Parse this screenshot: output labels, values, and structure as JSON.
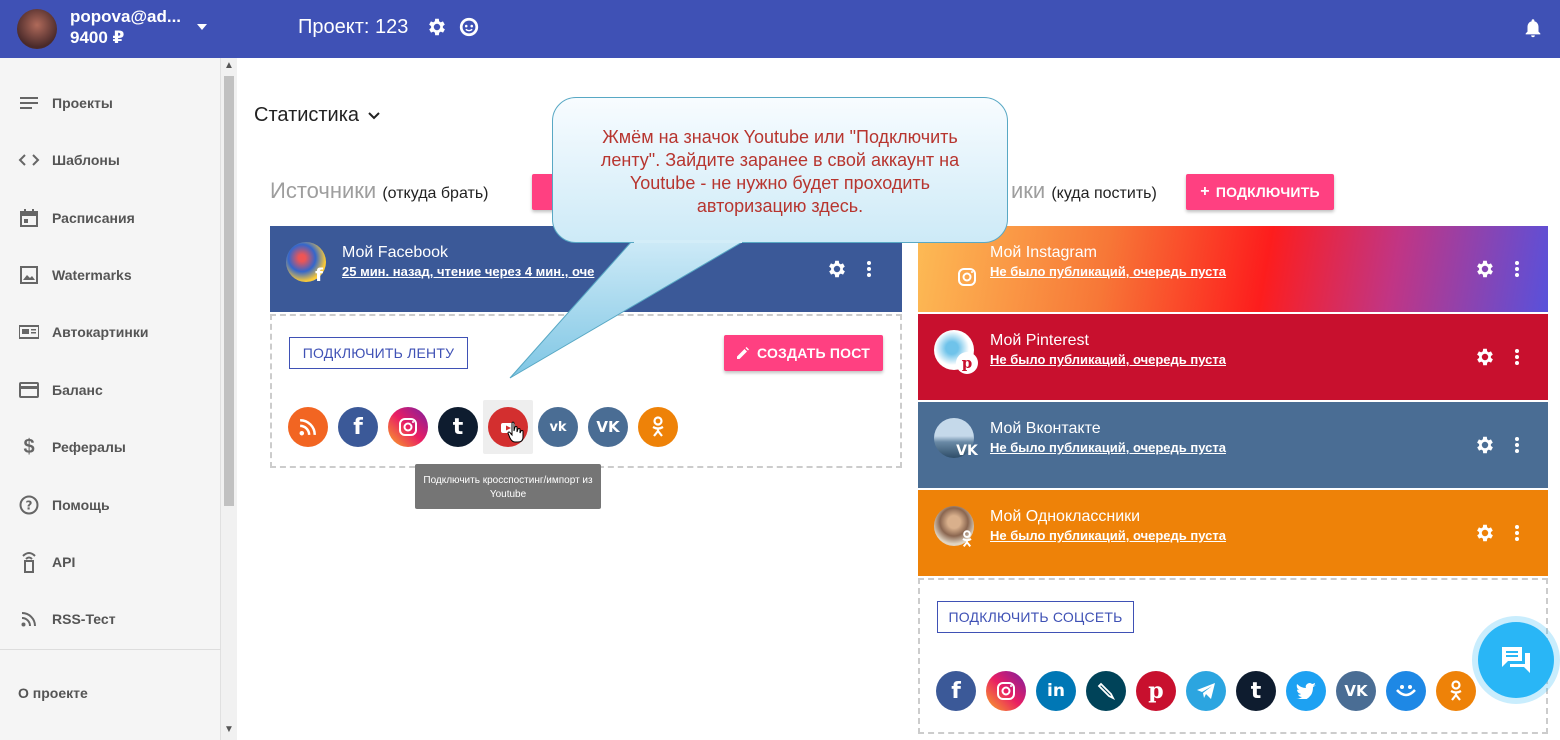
{
  "header": {
    "user_name": "popova@ad...",
    "balance": "9400 ₽",
    "project_title": "Проект: 123"
  },
  "sidebar": {
    "items": [
      {
        "label": "Проекты",
        "icon": "list-icon"
      },
      {
        "label": "Шаблоны",
        "icon": "code-icon"
      },
      {
        "label": "Расписания",
        "icon": "calendar-icon"
      },
      {
        "label": "Watermarks",
        "icon": "image-icon"
      },
      {
        "label": "Автокартинки",
        "icon": "featured-video-icon"
      },
      {
        "label": "Баланс",
        "icon": "credit-card-icon"
      },
      {
        "label": "Рефералы",
        "icon": "dollar-icon"
      },
      {
        "label": "Помощь",
        "icon": "help-icon"
      },
      {
        "label": "API",
        "icon": "api-icon"
      },
      {
        "label": "RSS-Тест",
        "icon": "rss-icon"
      }
    ],
    "about": "О проекте"
  },
  "stats": {
    "title": "Статистика"
  },
  "sources": {
    "title": "Источники",
    "subtitle": "(откуда брать)",
    "card": {
      "name": "Мой Facebook",
      "sub": "25 мин. назад, чтение через 4 мин., оче"
    },
    "connect_feed": "ПОДКЛЮЧИТЬ ЛЕНТУ",
    "create_post": "СОЗДАТЬ ПОСТ",
    "icons": [
      "rss-icon",
      "facebook-icon",
      "instagram-icon",
      "tumblr-icon",
      "youtube-icon",
      "vk-repost-icon",
      "vk-icon",
      "odnoklassniki-icon"
    ],
    "tooltip": "Подключить кросспостинг/импорт из Youtube"
  },
  "targets": {
    "title": "ики",
    "subtitle": "(куда постить)",
    "connect": "ПОДКЛЮЧИТЬ",
    "cards": [
      {
        "name": "Мой Instagram",
        "sub": "Не было публикаций, очередь пуста"
      },
      {
        "name": "Мой Pinterest",
        "sub": "Не было публикаций, очередь пуста"
      },
      {
        "name": "Мой Вконтакте",
        "sub": "Не было публикаций, очередь пуста"
      },
      {
        "name": "Мой Одноклассники",
        "sub": "Не было публикаций, очередь пуста"
      }
    ],
    "connect_social": "ПОДКЛЮЧИТЬ СОЦСЕТЬ",
    "icons": [
      "facebook-icon",
      "instagram-icon",
      "linkedin-icon",
      "livejournal-icon",
      "pinterest-icon",
      "telegram-icon",
      "tumblr-icon",
      "twitter-icon",
      "vk-icon",
      "smile-icon",
      "odnoklassniki-icon"
    ]
  },
  "callout": {
    "text": "Жмём на значок Youtube или \"Подключить ленту\". Зайдите заранее в свой аккаунт на Youtube -  не нужно будет проходить авторизацию здесь."
  },
  "colors": {
    "header": "#3f51b5",
    "accent": "#ff4081",
    "facebook": "#3b5998",
    "pinterest": "#c8102e",
    "vk": "#4a6d94",
    "ok": "#ee8208"
  }
}
